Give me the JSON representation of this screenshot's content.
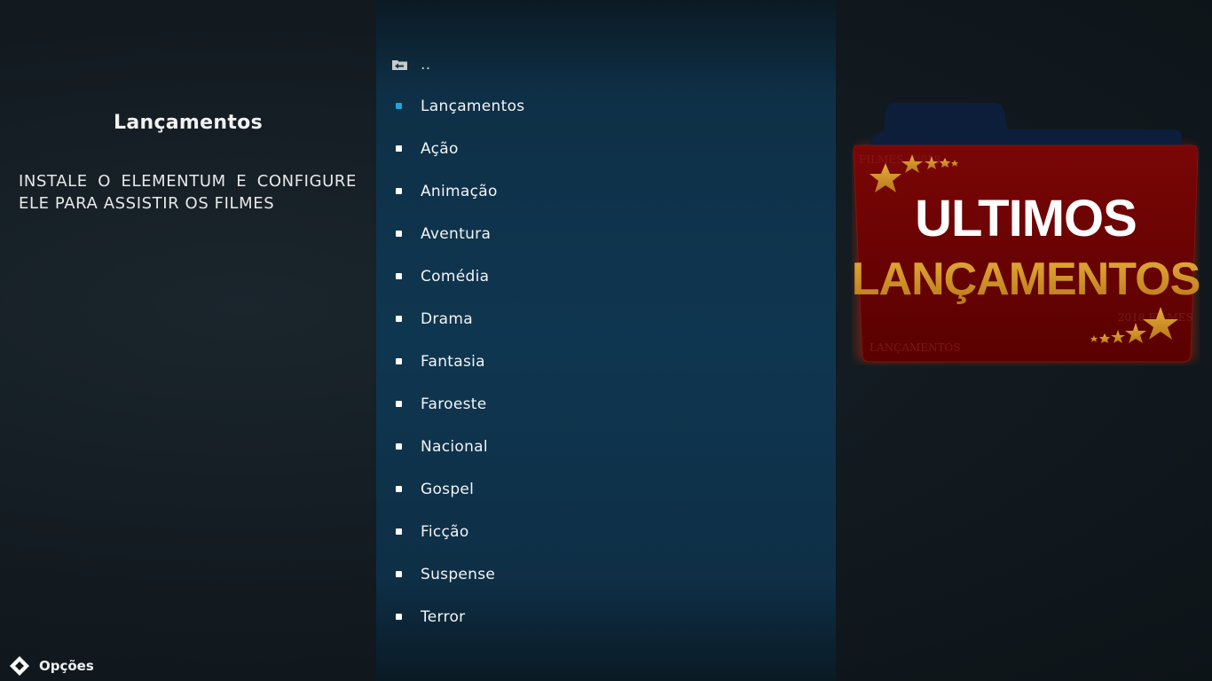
{
  "info": {
    "title": "Lançamentos",
    "plot": "INSTALE O ELEMENTUM E CONFIGURE ELE PARA ASSISTIR OS FILMES"
  },
  "list": {
    "parent_label": "..",
    "items": [
      {
        "label": "Lançamentos",
        "selected": true
      },
      {
        "label": "Ação"
      },
      {
        "label": "Animação"
      },
      {
        "label": "Aventura"
      },
      {
        "label": "Comédia"
      },
      {
        "label": "Drama"
      },
      {
        "label": "Fantasia"
      },
      {
        "label": "Faroeste"
      },
      {
        "label": "Nacional"
      },
      {
        "label": "Gospel"
      },
      {
        "label": "Ficção"
      },
      {
        "label": "Suspense"
      },
      {
        "label": "Terror"
      }
    ]
  },
  "poster": {
    "line1": "ULTIMOS",
    "line2": "LANÇAMENTOS",
    "icon": "folder-poster-icon"
  },
  "bottom": {
    "options_label": "Opções",
    "options_icon": "options-icon"
  },
  "colors": {
    "accent": "#1fa3d8",
    "poster_red": "#6b0000",
    "poster_gold": "#d4962a",
    "folder_navy": "#0c1e3a"
  }
}
